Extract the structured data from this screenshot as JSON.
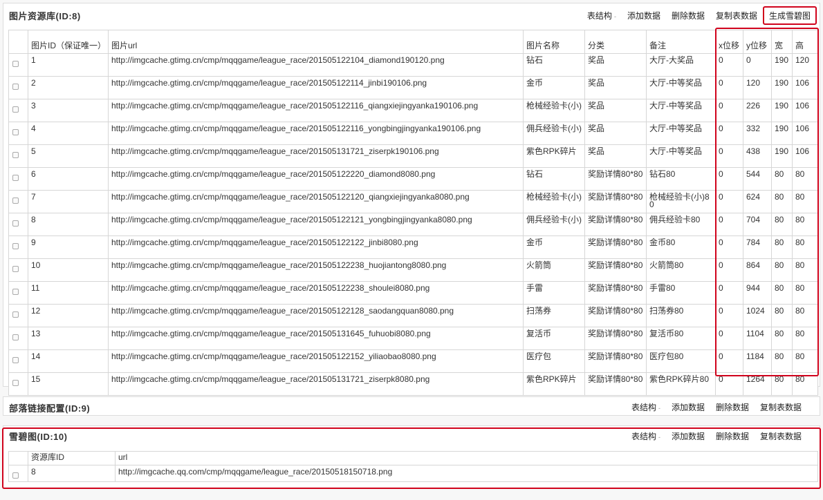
{
  "panel1": {
    "title": "图片资源库(ID:8)",
    "toolbar": {
      "structure": "表结构",
      "caret": "-",
      "add": "添加数据",
      "delete": "删除数据",
      "copy": "复制表数据",
      "generate": "生成雪碧图"
    },
    "columns": [
      "",
      "图片ID（保证唯一）",
      "图片url",
      "图片名称",
      "分类",
      "备注",
      "x位移",
      "y位移",
      "宽",
      "高"
    ],
    "rows": [
      {
        "id": "1",
        "url": "http://imgcache.gtimg.cn/cmp/mqqgame/league_race/201505122104_diamond190120.png",
        "name": "钻石",
        "category": "奖品",
        "remark": "大厅-大奖品",
        "x": "0",
        "y": "0",
        "w": "190",
        "h": "120"
      },
      {
        "id": "2",
        "url": "http://imgcache.gtimg.cn/cmp/mqqgame/league_race/201505122114_jinbi190106.png",
        "name": "金币",
        "category": "奖品",
        "remark": "大厅-中等奖品",
        "x": "0",
        "y": "120",
        "w": "190",
        "h": "106"
      },
      {
        "id": "3",
        "url": "http://imgcache.gtimg.cn/cmp/mqqgame/league_race/201505122116_qiangxiejingyanka190106.png",
        "name": "枪械经验卡(小)",
        "category": "奖品",
        "remark": "大厅-中等奖品",
        "x": "0",
        "y": "226",
        "w": "190",
        "h": "106"
      },
      {
        "id": "4",
        "url": "http://imgcache.gtimg.cn/cmp/mqqgame/league_race/201505122116_yongbingjingyanka190106.png",
        "name": "佣兵经验卡(小)",
        "category": "奖品",
        "remark": "大厅-中等奖品",
        "x": "0",
        "y": "332",
        "w": "190",
        "h": "106"
      },
      {
        "id": "5",
        "url": "http://imgcache.gtimg.cn/cmp/mqqgame/league_race/201505131721_ziserpk190106.png",
        "name": "紫色RPK碎片",
        "category": "奖品",
        "remark": "大厅-中等奖品",
        "x": "0",
        "y": "438",
        "w": "190",
        "h": "106"
      },
      {
        "id": "6",
        "url": "http://imgcache.gtimg.cn/cmp/mqqgame/league_race/201505122220_diamond8080.png",
        "name": "钻石",
        "category": "奖励详情80*80",
        "remark": "钻石80",
        "x": "0",
        "y": "544",
        "w": "80",
        "h": "80"
      },
      {
        "id": "7",
        "url": "http://imgcache.gtimg.cn/cmp/mqqgame/league_race/201505122120_qiangxiejingyanka8080.png",
        "name": "枪械经验卡(小)",
        "category": "奖励详情80*80",
        "remark": "枪械经验卡(小)80",
        "x": "0",
        "y": "624",
        "w": "80",
        "h": "80"
      },
      {
        "id": "8",
        "url": "http://imgcache.gtimg.cn/cmp/mqqgame/league_race/201505122121_yongbingjingyanka8080.png",
        "name": "佣兵经验卡(小)",
        "category": "奖励详情80*80",
        "remark": "佣兵经验卡80",
        "x": "0",
        "y": "704",
        "w": "80",
        "h": "80"
      },
      {
        "id": "9",
        "url": "http://imgcache.gtimg.cn/cmp/mqqgame/league_race/201505122122_jinbi8080.png",
        "name": "金币",
        "category": "奖励详情80*80",
        "remark": "金币80",
        "x": "0",
        "y": "784",
        "w": "80",
        "h": "80"
      },
      {
        "id": "10",
        "url": "http://imgcache.gtimg.cn/cmp/mqqgame/league_race/201505122238_huojiantong8080.png",
        "name": "火箭筒",
        "category": "奖励详情80*80",
        "remark": "火箭筒80",
        "x": "0",
        "y": "864",
        "w": "80",
        "h": "80"
      },
      {
        "id": "11",
        "url": "http://imgcache.gtimg.cn/cmp/mqqgame/league_race/201505122238_shoulei8080.png",
        "name": "手雷",
        "category": "奖励详情80*80",
        "remark": "手雷80",
        "x": "0",
        "y": "944",
        "w": "80",
        "h": "80"
      },
      {
        "id": "12",
        "url": "http://imgcache.gtimg.cn/cmp/mqqgame/league_race/201505122128_saodangquan8080.png",
        "name": "扫荡券",
        "category": "奖励详情80*80",
        "remark": "扫荡券80",
        "x": "0",
        "y": "1024",
        "w": "80",
        "h": "80"
      },
      {
        "id": "13",
        "url": "http://imgcache.gtimg.cn/cmp/mqqgame/league_race/201505131645_fuhuobi8080.png",
        "name": "复活币",
        "category": "奖励详情80*80",
        "remark": "复活币80",
        "x": "0",
        "y": "1104",
        "w": "80",
        "h": "80"
      },
      {
        "id": "14",
        "url": "http://imgcache.gtimg.cn/cmp/mqqgame/league_race/201505122152_yiliaobao8080.png",
        "name": "医疗包",
        "category": "奖励详情80*80",
        "remark": "医疗包80",
        "x": "0",
        "y": "1184",
        "w": "80",
        "h": "80"
      },
      {
        "id": "15",
        "url": "http://imgcache.gtimg.cn/cmp/mqqgame/league_race/201505131721_ziserpk8080.png",
        "name": "紫色RPK碎片",
        "category": "奖励详情80*80",
        "remark": "紫色RPK碎片80",
        "x": "0",
        "y": "1264",
        "w": "80",
        "h": "80"
      }
    ]
  },
  "panel2": {
    "title": "部落链接配置(ID:9)",
    "toolbar": {
      "structure": "表结构",
      "caret": "-",
      "add": "添加数据",
      "delete": "删除数据",
      "copy": "复制表数据"
    }
  },
  "panel3": {
    "title": "雪碧图(ID:10)",
    "toolbar": {
      "structure": "表结构",
      "caret": "-",
      "add": "添加数据",
      "delete": "删除数据",
      "copy": "复制表数据"
    },
    "columns": [
      "",
      "资源库ID",
      "url"
    ],
    "rows": [
      {
        "id": "8",
        "url": "http://imgcache.qq.com/cmp/mqqgame/league_race/20150518150718.png"
      }
    ]
  },
  "colors": {
    "highlight": "#d0021b",
    "border": "#d6d6d6"
  }
}
